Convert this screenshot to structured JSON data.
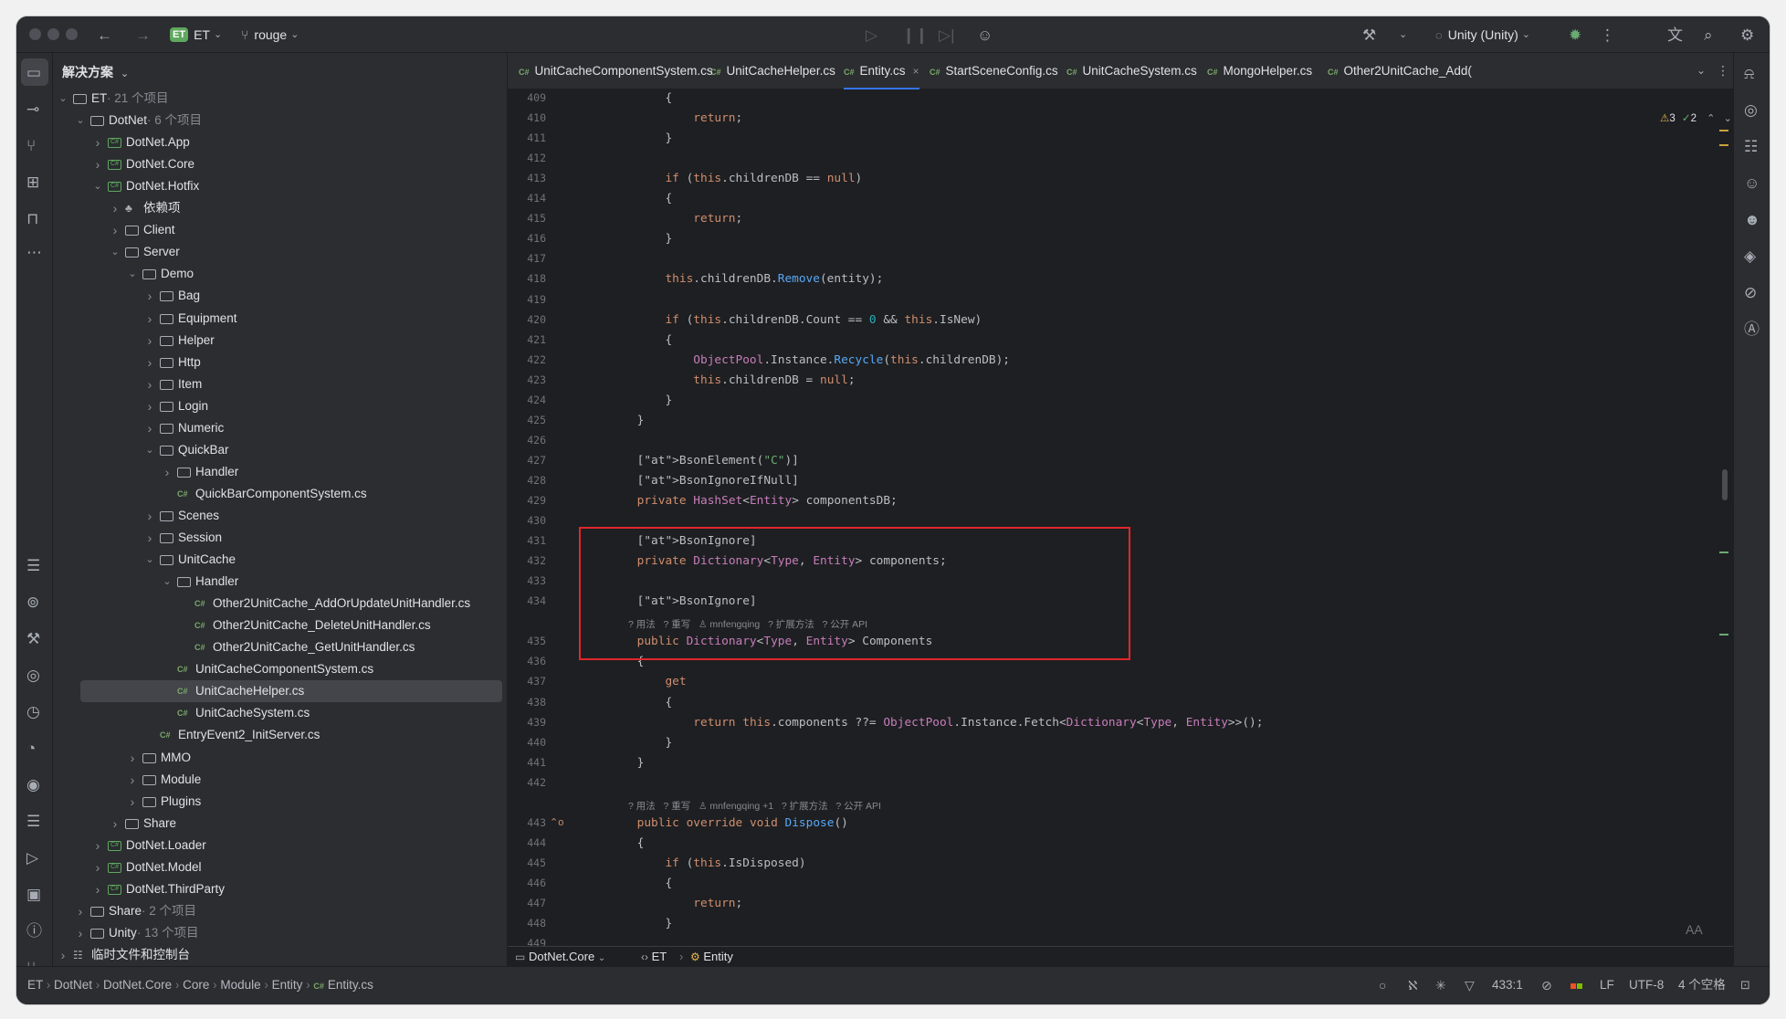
{
  "titlebar": {
    "project_badge": "ET",
    "project_name": "ET",
    "branch": "rouge",
    "run_config": "Unity (Unity)"
  },
  "project_panel": {
    "title": "解决方案",
    "tree": [
      {
        "label": "ET",
        "count": " · 21 个项目",
        "icon": "solution",
        "depth": 0,
        "open": true
      },
      {
        "label": "DotNet",
        "count": " · 6 个项目",
        "icon": "solution",
        "depth": 1,
        "open": true
      },
      {
        "label": "DotNet.App",
        "icon": "project",
        "depth": 2,
        "open": false
      },
      {
        "label": "DotNet.Core",
        "icon": "project",
        "depth": 2,
        "open": false
      },
      {
        "label": "DotNet.Hotfix",
        "icon": "project",
        "depth": 2,
        "open": true
      },
      {
        "label": "依赖项",
        "icon": "deps",
        "depth": 3,
        "open": false
      },
      {
        "label": "Client",
        "icon": "solution",
        "depth": 3,
        "open": false
      },
      {
        "label": "Server",
        "icon": "solution",
        "depth": 3,
        "open": true
      },
      {
        "label": "Demo",
        "icon": "folder",
        "depth": 4,
        "open": true
      },
      {
        "label": "Bag",
        "icon": "folder",
        "depth": 5,
        "open": false
      },
      {
        "label": "Equipment",
        "icon": "folder",
        "depth": 5,
        "open": false
      },
      {
        "label": "Helper",
        "icon": "folder",
        "depth": 5,
        "open": false
      },
      {
        "label": "Http",
        "icon": "folder",
        "depth": 5,
        "open": false
      },
      {
        "label": "Item",
        "icon": "folder",
        "depth": 5,
        "open": false
      },
      {
        "label": "Login",
        "icon": "folder",
        "depth": 5,
        "open": false
      },
      {
        "label": "Numeric",
        "icon": "folder",
        "depth": 5,
        "open": false
      },
      {
        "label": "QuickBar",
        "icon": "folder",
        "depth": 5,
        "open": true
      },
      {
        "label": "Handler",
        "icon": "folder",
        "depth": 6,
        "open": false
      },
      {
        "label": "QuickBarComponentSystem.cs",
        "icon": "cs",
        "depth": 6
      },
      {
        "label": "Scenes",
        "icon": "folder",
        "depth": 5,
        "open": false
      },
      {
        "label": "Session",
        "icon": "folder",
        "depth": 5,
        "open": false
      },
      {
        "label": "UnitCache",
        "icon": "folder",
        "depth": 5,
        "open": true
      },
      {
        "label": "Handler",
        "icon": "folder",
        "depth": 6,
        "open": true
      },
      {
        "label": "Other2UnitCache_AddOrUpdateUnitHandler.cs",
        "icon": "cs",
        "depth": 7
      },
      {
        "label": "Other2UnitCache_DeleteUnitHandler.cs",
        "icon": "cs",
        "depth": 7
      },
      {
        "label": "Other2UnitCache_GetUnitHandler.cs",
        "icon": "cs",
        "depth": 7
      },
      {
        "label": "UnitCacheComponentSystem.cs",
        "icon": "cs",
        "depth": 6
      },
      {
        "label": "UnitCacheHelper.cs",
        "icon": "cs",
        "depth": 6,
        "selected": true
      },
      {
        "label": "UnitCacheSystem.cs",
        "icon": "cs",
        "depth": 6
      },
      {
        "label": "EntryEvent2_InitServer.cs",
        "icon": "cs",
        "depth": 5
      },
      {
        "label": "MMO",
        "icon": "folder",
        "depth": 4,
        "open": false
      },
      {
        "label": "Module",
        "icon": "folder",
        "depth": 4,
        "open": false
      },
      {
        "label": "Plugins",
        "icon": "folder",
        "depth": 4,
        "open": false
      },
      {
        "label": "Share",
        "icon": "solution",
        "depth": 3,
        "open": false
      },
      {
        "label": "DotNet.Loader",
        "icon": "project",
        "depth": 2,
        "open": false
      },
      {
        "label": "DotNet.Model",
        "icon": "project",
        "depth": 2,
        "open": false
      },
      {
        "label": "DotNet.ThirdParty",
        "icon": "project",
        "depth": 2,
        "open": false
      },
      {
        "label": "Share",
        "count": " · 2 个项目",
        "icon": "solution",
        "depth": 1,
        "open": false
      },
      {
        "label": "Unity",
        "count": " · 13 个项目",
        "icon": "solution",
        "depth": 1,
        "open": false
      },
      {
        "label": "临时文件和控制台",
        "icon": "scratch",
        "depth": 0,
        "open": false
      }
    ]
  },
  "tabs": [
    {
      "label": "UnitCacheComponentSystem.cs",
      "lang": "C#"
    },
    {
      "label": "UnitCacheHelper.cs",
      "lang": "C#"
    },
    {
      "label": "Entity.cs",
      "lang": "C#",
      "active": true
    },
    {
      "label": "StartSceneConfig.cs",
      "lang": "C#"
    },
    {
      "label": "UnitCacheSystem.cs",
      "lang": "C#"
    },
    {
      "label": "MongoHelper.cs",
      "lang": "C#"
    },
    {
      "label": "Other2UnitCache_Add(",
      "lang": "C#"
    }
  ],
  "inspections": {
    "warnings": "3",
    "ok": "2"
  },
  "code_lines": [
    {
      "n": "409",
      "t": "            {"
    },
    {
      "n": "410",
      "t": "                return;"
    },
    {
      "n": "411",
      "t": "            }"
    },
    {
      "n": "412",
      "t": ""
    },
    {
      "n": "413",
      "t": "            if (this.childrenDB == null)"
    },
    {
      "n": "414",
      "t": "            {"
    },
    {
      "n": "415",
      "t": "                return;"
    },
    {
      "n": "416",
      "t": "            }"
    },
    {
      "n": "417",
      "t": ""
    },
    {
      "n": "418",
      "t": "            this.childrenDB.Remove(entity);"
    },
    {
      "n": "419",
      "t": ""
    },
    {
      "n": "420",
      "t": "            if (this.childrenDB.Count == 0 && this.IsNew)"
    },
    {
      "n": "421",
      "t": "            {"
    },
    {
      "n": "422",
      "t": "                ObjectPool.Instance.Recycle(this.childrenDB);"
    },
    {
      "n": "423",
      "t": "                this.childrenDB = null;"
    },
    {
      "n": "424",
      "t": "            }"
    },
    {
      "n": "425",
      "t": "        }"
    },
    {
      "n": "426",
      "t": ""
    },
    {
      "n": "427",
      "t": "        [BsonElement(\"C\")]"
    },
    {
      "n": "428",
      "t": "        [BsonIgnoreIfNull]"
    },
    {
      "n": "429",
      "t": "        private HashSet<Entity> componentsDB;"
    },
    {
      "n": "430",
      "t": ""
    },
    {
      "n": "431",
      "t": "        [BsonIgnore]"
    },
    {
      "n": "432",
      "t": "        private Dictionary<Type, Entity> components;"
    },
    {
      "n": "433",
      "t": ""
    },
    {
      "n": "434",
      "t": "        [BsonIgnore]"
    },
    {
      "n": "",
      "hint": "? 用法   ? 重写   ♙ mnfengqing   ? 扩展方法   ? 公开 API"
    },
    {
      "n": "435",
      "t": "        public Dictionary<Type, Entity> Components"
    },
    {
      "n": "436",
      "t": "        {"
    },
    {
      "n": "437",
      "t": "            get"
    },
    {
      "n": "438",
      "t": "            {"
    },
    {
      "n": "439",
      "t": "                return this.components ??= ObjectPool.Instance.Fetch<Dictionary<Type, Entity>>();"
    },
    {
      "n": "440",
      "t": "            }"
    },
    {
      "n": "441",
      "t": "        }"
    },
    {
      "n": "442",
      "t": ""
    },
    {
      "n": "",
      "hint": "? 用法   ? 重写   ♙ mnfengqing +1   ? 扩展方法   ? 公开 API"
    },
    {
      "n": "443",
      "t": "        public override void Dispose()"
    },
    {
      "n": "444",
      "t": "        {"
    },
    {
      "n": "445",
      "t": "            if (this.IsDisposed)"
    },
    {
      "n": "446",
      "t": "            {"
    },
    {
      "n": "447",
      "t": "                return;"
    },
    {
      "n": "448",
      "t": "            }"
    },
    {
      "n": "449",
      "t": ""
    }
  ],
  "editor_breadcrumb": {
    "project": "DotNet.Core",
    "namespace": "ET",
    "class": "Entity"
  },
  "statusbar": {
    "path": [
      "ET",
      "DotNet",
      "DotNet.Core",
      "Core",
      "Module",
      "Entity",
      "Entity.cs"
    ],
    "position": "433:1",
    "line_sep": "LF",
    "encoding": "UTF-8",
    "indent": "4 个空格"
  },
  "colors": {
    "accent": "#3574f0",
    "highlight_box": "#e0262b",
    "background": "#1e1f22"
  }
}
